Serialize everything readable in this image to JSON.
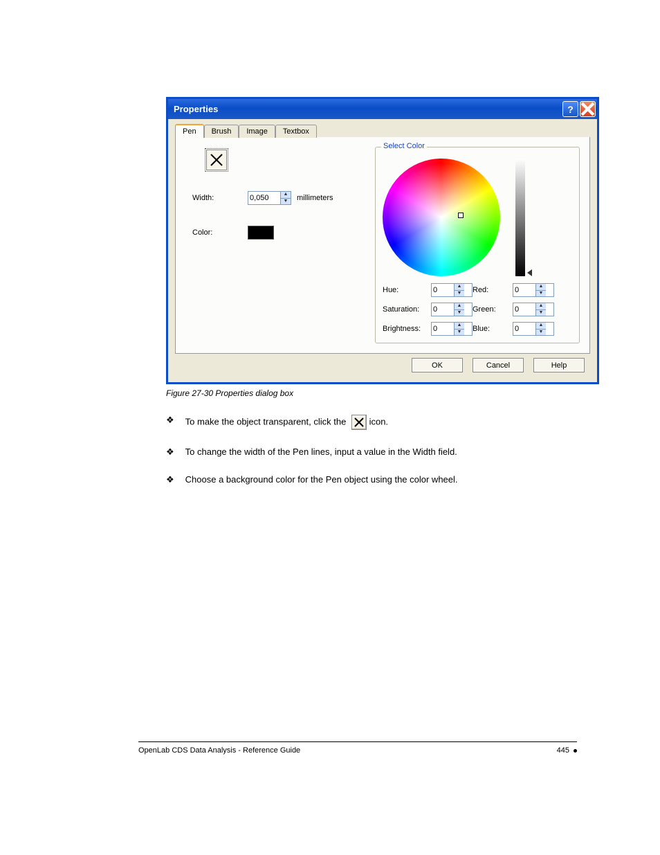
{
  "dialog": {
    "title": "Properties",
    "tabs": [
      "Pen",
      "Brush",
      "Image",
      "Textbox"
    ],
    "active_tab": 0,
    "left": {
      "width_label": "Width:",
      "width_value": "0,050",
      "width_unit": "millimeters",
      "color_label": "Color:"
    },
    "group": {
      "legend": "Select Color",
      "hue_label": "Hue:",
      "saturation_label": "Saturation:",
      "brightness_label": "Brightness:",
      "red_label": "Red:",
      "green_label": "Green:",
      "blue_label": "Blue:",
      "hue_value": "0",
      "saturation_value": "0",
      "brightness_value": "0",
      "red_value": "0",
      "green_value": "0",
      "blue_value": "0"
    },
    "buttons": {
      "ok": "OK",
      "cancel": "Cancel",
      "help": "Help"
    }
  },
  "caption": "Figure 27-30 Properties dialog box",
  "bullets": [
    "To make the object transparent, click the  ",
    "To change the width of the Pen lines, input a value in the Width field.",
    "Choose a background color for the Pen object using the color wheel."
  ],
  "bullet0_suffix": " icon.",
  "footer": {
    "left": "OpenLab CDS Data Analysis - Reference Guide",
    "right": "445"
  }
}
